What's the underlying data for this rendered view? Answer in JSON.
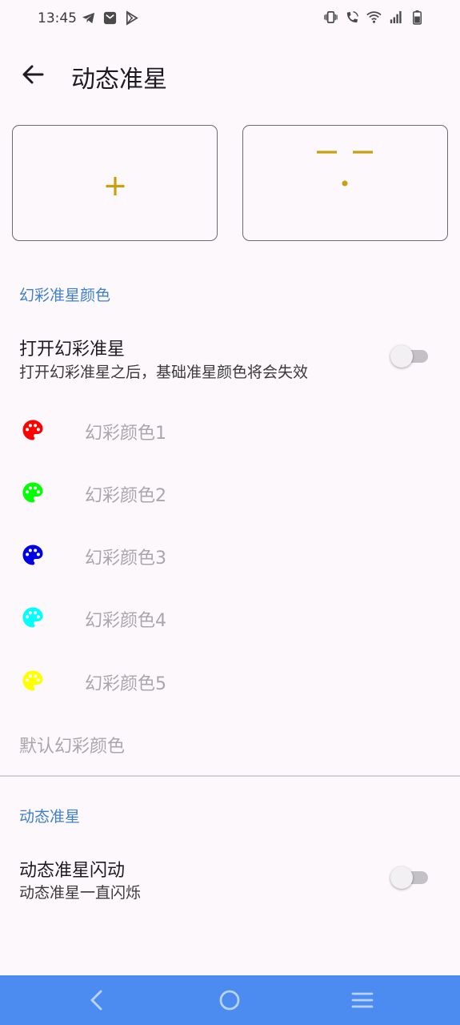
{
  "status_bar": {
    "time": "13:45",
    "left_icons": [
      "telegram-icon",
      "mail-icon",
      "play-store-icon"
    ],
    "right_icons": [
      "vibrate-icon",
      "wifi-call-icon",
      "wifi-icon",
      "signal-icon",
      "battery-icon"
    ]
  },
  "app_bar": {
    "title": "动态准星",
    "back_icon": "arrow-back-icon"
  },
  "preview": {
    "accent_color": "#c9a010",
    "left_symbol": "plus-crosshair",
    "right_symbol": "dash-dot-crosshair"
  },
  "section_rainbow": {
    "header": "幻彩准星颜色",
    "toggle": {
      "title": "打开幻彩准星",
      "subtitle": "打开幻彩准星之后，基础准星颜色将会失效",
      "on": false
    },
    "colors": [
      {
        "label": "幻彩颜色1",
        "color": "#ff0000",
        "icon": "palette-icon"
      },
      {
        "label": "幻彩颜色2",
        "color": "#00ff00",
        "icon": "palette-icon"
      },
      {
        "label": "幻彩颜色3",
        "color": "#0000e6",
        "icon": "palette-icon"
      },
      {
        "label": "幻彩颜色4",
        "color": "#00ffff",
        "icon": "palette-icon"
      },
      {
        "label": "幻彩颜色5",
        "color": "#ffff00",
        "icon": "palette-icon"
      }
    ],
    "default_label": "默认幻彩颜色"
  },
  "section_dynamic": {
    "header": "动态准星",
    "toggle": {
      "title": "动态准星闪动",
      "subtitle": "动态准星一直闪烁",
      "on": false
    }
  },
  "nav_bar": {
    "color": "#4c8bf0",
    "buttons": [
      "back-nav-icon",
      "home-nav-icon",
      "menu-nav-icon"
    ]
  }
}
